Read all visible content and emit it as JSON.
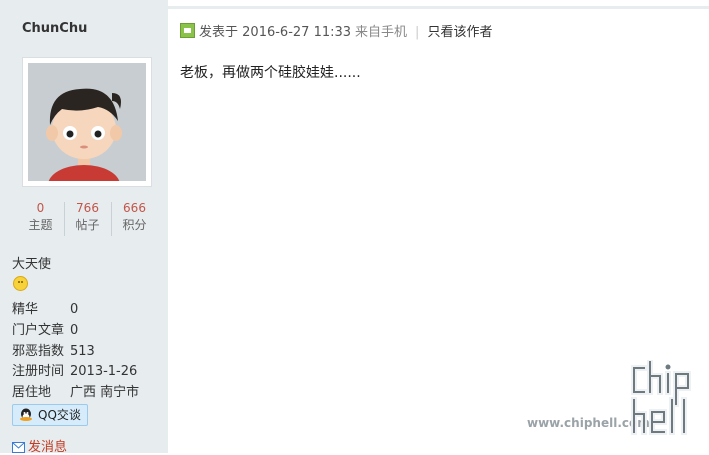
{
  "user": {
    "name": "ChunChu",
    "stats": [
      {
        "value": "0",
        "label": "主题"
      },
      {
        "value": "766",
        "label": "帖子"
      },
      {
        "value": "666",
        "label": "积分"
      }
    ],
    "group": "大天使",
    "info": [
      {
        "key": "精华",
        "value": "0"
      },
      {
        "key": "门户文章",
        "value": "0"
      },
      {
        "key": "邪恶指数",
        "value": "513"
      },
      {
        "key": "注册时间",
        "value": "2013-1-26"
      },
      {
        "key": "居住地",
        "value": "广西 南宁市"
      }
    ],
    "qq_label": "QQ交谈",
    "message_label": "发消息"
  },
  "post": {
    "posted_label": "发表于",
    "datetime": "2016-6-27 11:33",
    "device": "来自手机",
    "separator": "|",
    "only_author": "只看该作者",
    "content": "老板，再做两个硅胶娃娃......"
  },
  "watermark": {
    "url": "www.chiphell.com"
  },
  "colors": {
    "sidebar_bg": "#e7ecef",
    "stat_number": "#c2564a",
    "message_link": "#c23b22"
  }
}
